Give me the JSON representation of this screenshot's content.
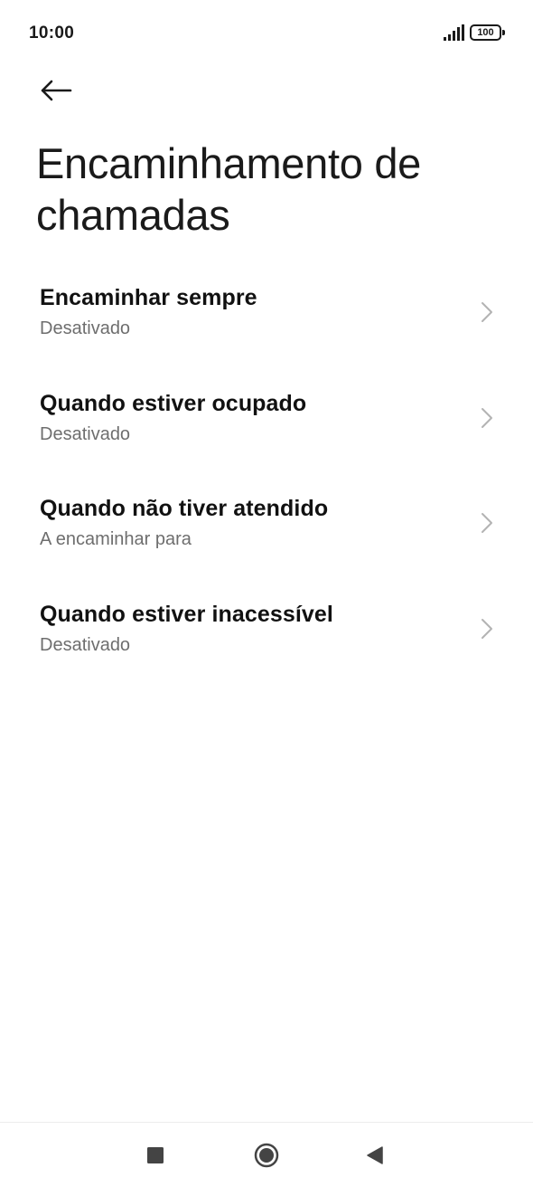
{
  "status_bar": {
    "time": "10:00",
    "signal_icon": "signal-bars-icon",
    "battery_level": "100"
  },
  "header": {
    "back_icon": "arrow-left-icon",
    "title": "Encaminhamento de chamadas"
  },
  "items": [
    {
      "title": "Encaminhar sempre",
      "subtitle": "Desativado"
    },
    {
      "title": "Quando estiver ocupado",
      "subtitle": "Desativado"
    },
    {
      "title": "Quando não tiver atendido",
      "subtitle": "A encaminhar para"
    },
    {
      "title": "Quando estiver inacessível",
      "subtitle": "Desativado"
    }
  ],
  "nav_bar": {
    "recents_icon": "square-icon",
    "home_icon": "circle-icon",
    "back_icon": "triangle-back-icon"
  },
  "colors": {
    "background": "#ffffff",
    "title_text": "#1a1a1a",
    "subtitle_text": "#6e6e6e",
    "chevron": "#b3b3b3",
    "nav_icons": "#444444"
  }
}
